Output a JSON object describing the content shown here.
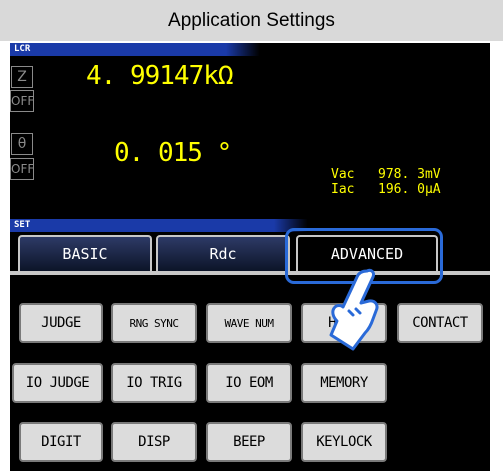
{
  "caption": "Application Settings",
  "lcr": {
    "header": "LCR",
    "param1": "Z",
    "param1_comp": "OFF",
    "value1": "4. 99147kΩ",
    "param2": "θ",
    "param2_comp": "OFF",
    "value2": "0. 015 °",
    "vac_label": "Vac",
    "vac_value": "978. 3mV",
    "iac_label": "Iac",
    "iac_value": "196. 0μA"
  },
  "set": {
    "header": "SET",
    "tabs": [
      {
        "label": "BASIC"
      },
      {
        "label": "Rdc"
      },
      {
        "label": "ADVANCED"
      }
    ],
    "active_tab": "ADVANCED",
    "buttons": [
      {
        "label": "JUDGE"
      },
      {
        "label": "RNG SYNC"
      },
      {
        "label": "WAVE NUM"
      },
      {
        "label": "Hi Z"
      },
      {
        "label": "CONTACT"
      },
      {
        "label": "IO JUDGE"
      },
      {
        "label": "IO TRIG"
      },
      {
        "label": "IO EOM"
      },
      {
        "label": "MEMORY"
      },
      {
        "label": "DIGIT"
      },
      {
        "label": "DISP"
      },
      {
        "label": "BEEP"
      },
      {
        "label": "KEYLOCK"
      }
    ]
  },
  "colors": {
    "value": "#ffff00",
    "header_blue": "#1a3aa8",
    "highlight": "#2a6ad8"
  },
  "icons": {
    "pointer": "hand-pointer-icon"
  }
}
